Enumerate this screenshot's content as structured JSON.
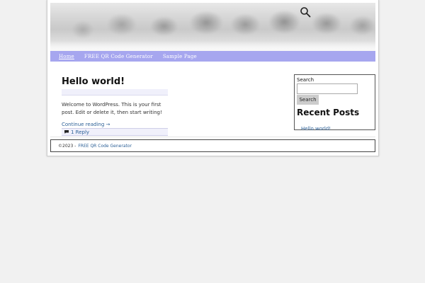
{
  "header": {
    "search_icon": "search-icon"
  },
  "nav": {
    "items": [
      {
        "label": "Home",
        "current": true
      },
      {
        "label": "FREE QR Code Generator",
        "current": false
      },
      {
        "label": "Sample Page",
        "current": false
      }
    ]
  },
  "post": {
    "title": "Hello world!",
    "body": "Welcome to WordPress. This is your first post. Edit or delete it, then start writing!",
    "continue_label": "Continue reading →",
    "comments_label": "1 Reply",
    "comment_icon": "comment-icon"
  },
  "sidebar": {
    "search_label": "Search",
    "search_value": "",
    "search_button": "Search",
    "recent_heading": "Recent Posts",
    "recent_items": [
      "Hello world!"
    ]
  },
  "footer": {
    "copyright": "©2023 -",
    "link": "FREE QR Code Generator"
  },
  "colors": {
    "nav_bg": "#a6a6ef",
    "link": "#2b5f96",
    "page_bg": "#f1f1f1"
  }
}
